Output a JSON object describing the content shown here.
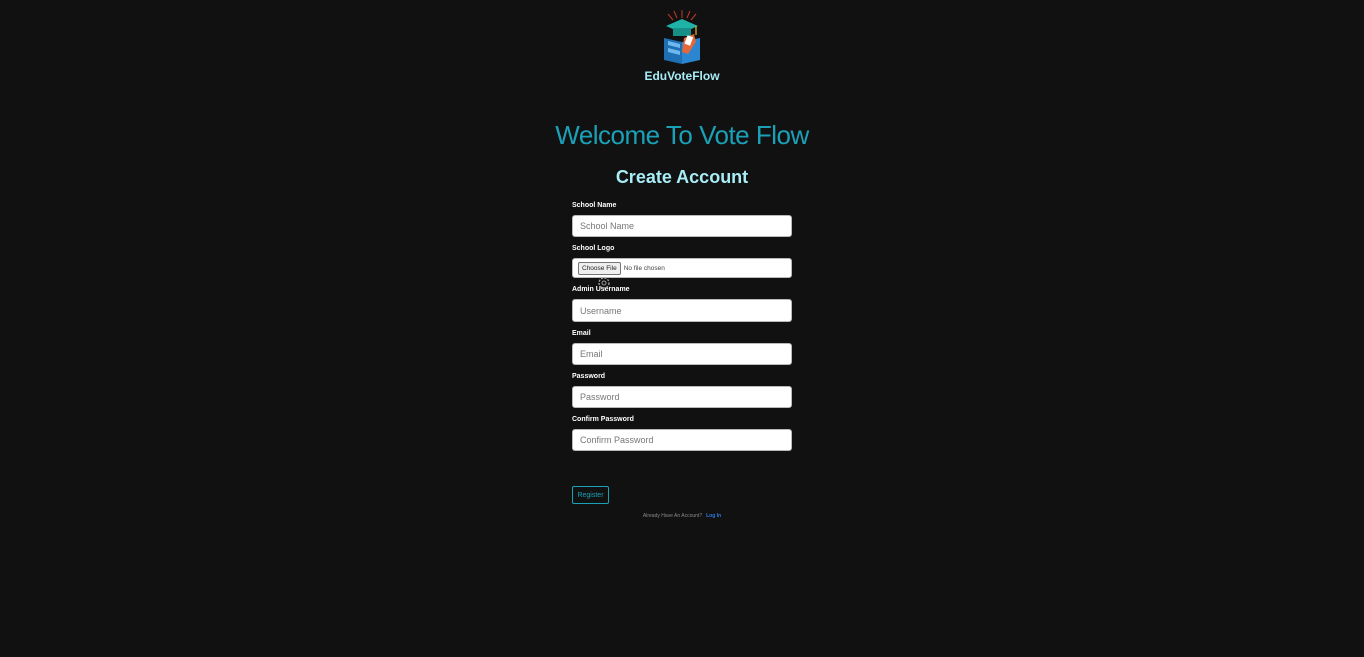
{
  "brand": {
    "name": "EduVoteFlow"
  },
  "heading": {
    "welcome": "Welcome To Vote Flow",
    "subtitle": "Create Account"
  },
  "form": {
    "school_name": {
      "label": "School Name",
      "placeholder": "School Name",
      "value": ""
    },
    "school_logo": {
      "label": "School Logo",
      "button": "Choose File",
      "status": "No file chosen"
    },
    "admin_username": {
      "label": "Admin Username",
      "placeholder": "Username",
      "value": ""
    },
    "email": {
      "label": "Email",
      "placeholder": "Email",
      "value": ""
    },
    "password": {
      "label": "Password",
      "placeholder": "Password",
      "value": ""
    },
    "confirm_password": {
      "label": "Confirm Password",
      "placeholder": "Confirm Password",
      "value": ""
    },
    "register_label": "Register"
  },
  "footer": {
    "prompt": "Already Have An Account?",
    "login_label": "Log In"
  },
  "icons": {
    "logo": "graduation-cap-ballot-logo",
    "loader": "loading-spinner-icon"
  },
  "colors": {
    "background": "#111111",
    "accent": "#1aa1b8",
    "heading_light": "#a8ecf6",
    "link": "#2a7de8"
  }
}
